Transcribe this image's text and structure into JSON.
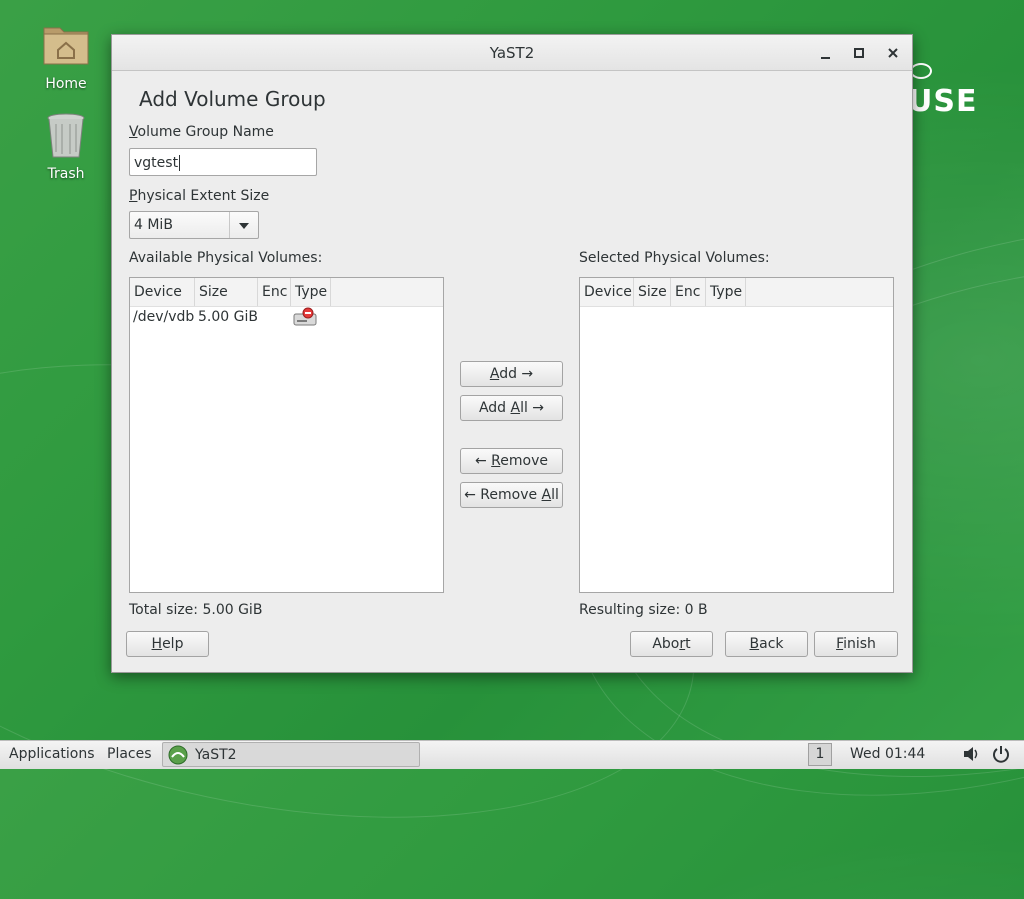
{
  "desktop": {
    "icons": [
      {
        "label": "Home",
        "icon": "home-folder-icon"
      },
      {
        "label": "Trash",
        "icon": "trash-icon"
      }
    ],
    "logo_text": "USE"
  },
  "window": {
    "title": "YaST2",
    "controls": {
      "minimize": "minimize-icon",
      "maximize": "maximize-icon",
      "close": "close-icon"
    }
  },
  "dialog": {
    "heading": "Add Volume Group",
    "vg_name_label_u": "V",
    "vg_name_label_rest": "olume Group Name",
    "vg_name_value": "vgtest",
    "pe_size_label_u": "P",
    "pe_size_label_rest": "hysical Extent Size",
    "pe_size_value": "4 MiB",
    "available_label": "Available Physical Volumes:",
    "selected_label": "Selected Physical Volumes:",
    "columns": [
      "Device",
      "Size",
      "Enc",
      "Type"
    ],
    "available_rows": [
      {
        "device": "/dev/vdb",
        "size": "5.00 GiB",
        "enc": "",
        "type": "harddisk-icon"
      }
    ],
    "selected_rows": [],
    "buttons": {
      "add_u": "A",
      "add_rest": "dd →",
      "add_all_pre": "Add ",
      "add_all_u": "A",
      "add_all_rest": "ll →",
      "remove_pre": "← ",
      "remove_u": "R",
      "remove_rest": "emove",
      "remove_all_pre": "← Remove ",
      "remove_all_u": "A",
      "remove_all_rest": "ll"
    },
    "total_size": "Total size: 5.00 GiB",
    "resulting_size": "Resulting size: 0 B",
    "footer": {
      "help_u": "H",
      "help_rest": "elp",
      "abort_pre": "Abo",
      "abort_u": "r",
      "abort_rest": "t",
      "back_u": "B",
      "back_rest": "ack",
      "finish_u": "F",
      "finish_rest": "inish"
    }
  },
  "taskbar": {
    "applications": "Applications",
    "places": "Places",
    "task": "YaST2",
    "workspace": "1",
    "clock": "Wed 01:44",
    "volume_icon": "volume-icon",
    "power_icon": "power-icon"
  }
}
